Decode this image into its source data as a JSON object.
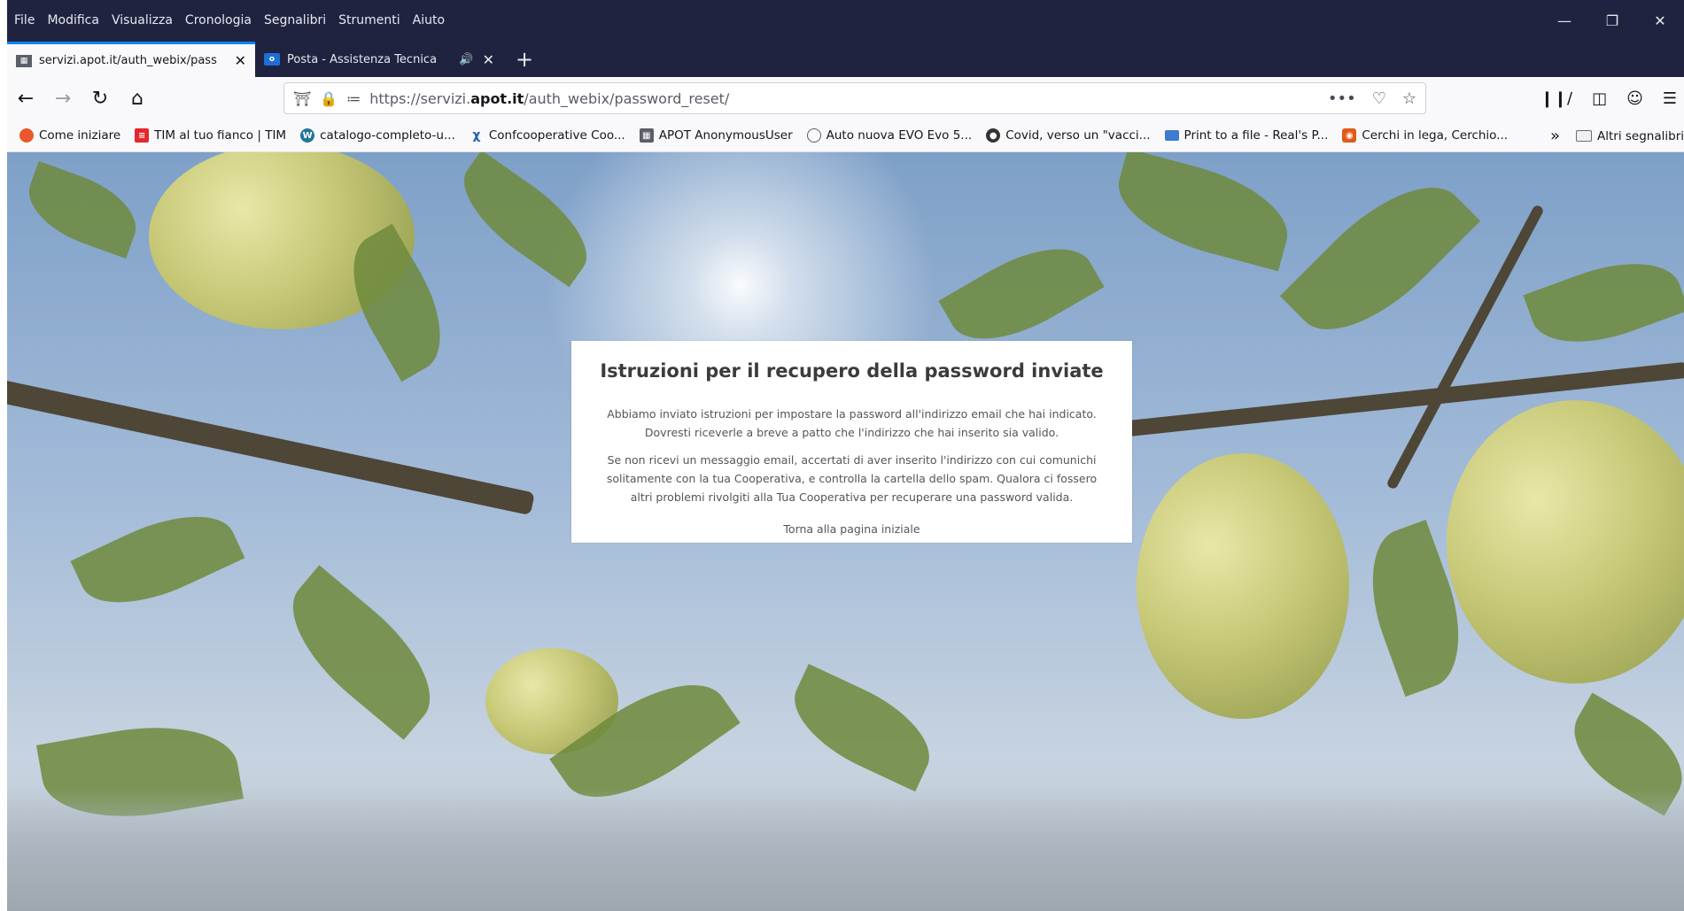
{
  "menubar": {
    "items": [
      "File",
      "Modifica",
      "Visualizza",
      "Cronologia",
      "Segnalibri",
      "Strumenti",
      "Aiuto"
    ]
  },
  "tabs": [
    {
      "title": "servizi.apot.it/auth_webix/pass",
      "favicon": "apot-icon",
      "active": true
    },
    {
      "title": "Posta - Assistenza Tecnica",
      "favicon": "outlook-icon",
      "active": false,
      "audio": true
    }
  ],
  "toolbar": {
    "url_prefix": "https://servizi.",
    "url_domain": "apot.it",
    "url_path": "/auth_webix/password_reset/",
    "page_actions": "•••"
  },
  "bookmarks": {
    "items": [
      {
        "label": "Come iniziare",
        "icon": "firefox-icon",
        "color": "#e8582c"
      },
      {
        "label": "TIM al tuo fianco | TIM",
        "icon": "tim-icon",
        "color": "#e4262f"
      },
      {
        "label": "catalogo-completo-u...",
        "icon": "wordpress-icon",
        "color": "#21759b"
      },
      {
        "label": "Confcooperative Coo...",
        "icon": "confcoop-icon",
        "color": "#2b5fb4"
      },
      {
        "label": "APOT AnonymousUser",
        "icon": "apot-icon",
        "color": "#5a5f69"
      },
      {
        "label": "Auto nuova EVO Evo 5...",
        "icon": "globe-icon",
        "color": "#5b5b66"
      },
      {
        "label": "Covid, verso un \"vacci...",
        "icon": "news-icon",
        "color": "#333333"
      },
      {
        "label": "Print to a file - Real's P...",
        "icon": "page-icon",
        "color": "#3e7bd1"
      },
      {
        "label": "Cerchi in lega, Cerchio...",
        "icon": "wheel-icon",
        "color": "#e05a17"
      }
    ],
    "overflow": "»",
    "other_folder": "Altri segnalibri"
  },
  "card": {
    "title": "Istruzioni per il recupero della password inviate",
    "para1_line1": "Abbiamo inviato istruzioni per impostare la password all'indirizzo email che hai indicato.",
    "para1_line2": "Dovresti riceverle a breve a patto che l'indirizzo che hai inserito sia valido.",
    "para2_line1": "Se non ricevi un messaggio email, accertati di aver inserito l'indirizzo con cui comunichi",
    "para2_line2": "solitamente con la tua Cooperativa, e controlla la cartella dello spam. Qualora ci fossero",
    "para2_line3": "altri problemi rivolgiti alla Tua Cooperativa per recuperare una password valida.",
    "link": "Torna alla pagina iniziale"
  },
  "colors": {
    "chrome_dark": "#202340",
    "tab_accent": "#0a84ff",
    "toolbar_bg": "#f9f9fb"
  }
}
